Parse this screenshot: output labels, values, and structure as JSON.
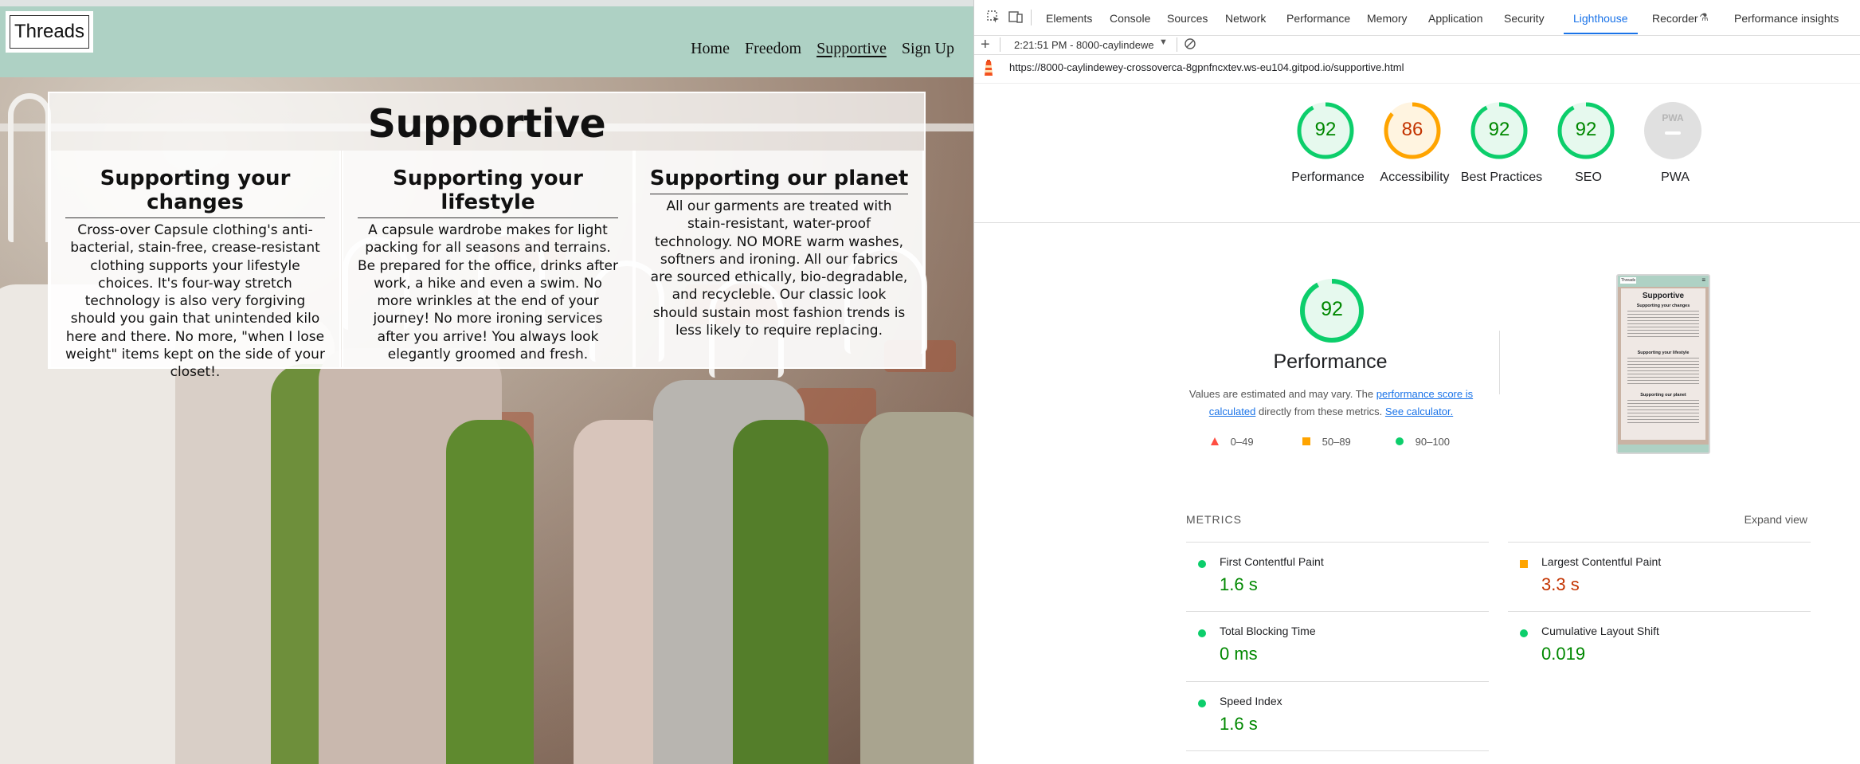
{
  "site": {
    "logo_text": "Threads",
    "nav": [
      {
        "label": "Home"
      },
      {
        "label": "Freedom"
      },
      {
        "label": "Supportive"
      },
      {
        "label": "Sign Up"
      }
    ],
    "active_nav": "Supportive",
    "panel_title": "Supportive",
    "columns": [
      {
        "heading": "Supporting your changes",
        "text": "Cross-over Capsule clothing's anti-bacterial, stain-free, crease-resistant clothing supports your lifestyle choices. It's four-way stretch technology is also very forgiving should you gain that unintended kilo here and there. No more, \"when I lose weight\" items kept on the side of your closet!."
      },
      {
        "heading": "Supporting your lifestyle",
        "text": "A capsule wardrobe makes for light packing for all seasons and terrains. Be prepared for the office, drinks after work, a hike and even a swim. No more wrinkles at the end of your journey! No more ironing services after you arrive! You always look elegantly groomed and fresh."
      },
      {
        "heading": "Supporting our planet",
        "text": "All our garments are treated with stain-resistant, water-proof technology. NO MORE warm washes, softners and ironing. All our fabrics are sourced ethically, bio-degradable, and recycleble. Our classic look should sustain most fashion trends is less likely to require replacing."
      }
    ],
    "header_color": "#aed1c4"
  },
  "devtools": {
    "tabs": [
      "Elements",
      "Console",
      "Sources",
      "Network",
      "Performance",
      "Memory",
      "Application",
      "Security",
      "Lighthouse",
      "Recorder",
      "Performance insights"
    ],
    "active_tab": "Lighthouse",
    "report_selector": "2:21:51 PM - 8000-caylindewe",
    "url": "https://8000-caylindewey-crossoverca-8gpnfncxtev.ws-eu104.gitpod.io/supportive.html",
    "gauges": [
      {
        "label": "Performance",
        "score": "92",
        "status": "pass"
      },
      {
        "label": "Accessibility",
        "score": "86",
        "status": "average"
      },
      {
        "label": "Best Practices",
        "score": "92",
        "status": "pass"
      },
      {
        "label": "SEO",
        "score": "92",
        "status": "pass"
      },
      {
        "label": "PWA",
        "score": "",
        "status": "na",
        "badge": "PWA"
      }
    ],
    "performance": {
      "score": "92",
      "title": "Performance",
      "desc_1": "Values are estimated and may vary. The",
      "desc_link": "performance score is calculated",
      "desc_2": "directly from these metrics.",
      "calc_link": "See calculator.",
      "legend": [
        {
          "range": "0–49",
          "shape": "triangle",
          "color": "#ff4e42"
        },
        {
          "range": "50–89",
          "shape": "square",
          "color": "#ffa400"
        },
        {
          "range": "90–100",
          "shape": "circle",
          "color": "#0cce6b"
        }
      ]
    },
    "metrics_heading": "METRICS",
    "expand_label": "Expand view",
    "metrics": [
      {
        "name": "First Contentful Paint",
        "value": "1.6 s",
        "status": "pass"
      },
      {
        "name": "Largest Contentful Paint",
        "value": "3.3 s",
        "status": "average"
      },
      {
        "name": "Total Blocking Time",
        "value": "0 ms",
        "status": "pass"
      },
      {
        "name": "Cumulative Layout Shift",
        "value": "0.019",
        "status": "pass"
      },
      {
        "name": "Speed Index",
        "value": "1.6 s",
        "status": "pass"
      }
    ],
    "thumbnail": {
      "title": "Supportive",
      "h1": "Supporting your changes",
      "h2": "Supporting your lifestyle",
      "h3": "Supporting our planet"
    },
    "colors": {
      "pass": "#0cce6b",
      "pass_text": "#008800",
      "average": "#ffa400",
      "average_text": "#c33300",
      "accent": "#1a73e8"
    }
  }
}
